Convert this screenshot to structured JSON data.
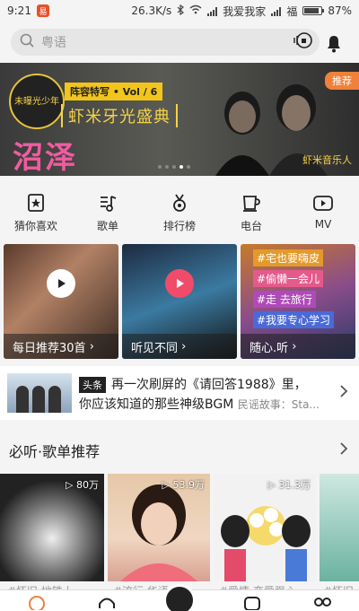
{
  "status_bar": {
    "time": "9:21",
    "notification_badge": "易",
    "network_speed": "26.3K/s",
    "carrier_1": "我爱我家",
    "carrier_2": "福",
    "battery": "87%",
    "battery_level": 0.87
  },
  "search": {
    "placeholder": "粤语",
    "icon": "search-icon",
    "voice_icon": "voice-recognition-icon",
    "bell_icon": "bell-icon"
  },
  "banner": {
    "circle_badge": "未曝光少年",
    "series": "阵容特写 • Vol / 6",
    "headline": "虾米牙光盛典",
    "artist_name": "沼泽",
    "tag": "推荐",
    "brand": "虾米音乐人",
    "dots": 5,
    "active_dot": 3
  },
  "nav": [
    {
      "label": "猜你喜欢",
      "icon": "heart-star-icon"
    },
    {
      "label": "歌单",
      "icon": "playlist-icon"
    },
    {
      "label": "排行榜",
      "icon": "medal-icon"
    },
    {
      "label": "电台",
      "icon": "cup-radio-icon"
    },
    {
      "label": "MV",
      "icon": "mv-play-icon"
    }
  ],
  "cards": [
    {
      "label": "每日推荐30首",
      "icon": "play-icon"
    },
    {
      "label": "听见不同",
      "icon": "play-icon"
    },
    {
      "label": "随心.听",
      "tags": [
        "#宅也要嗨皮",
        "#偷懒一会儿",
        "#走 去旅行",
        "#我要专心学习"
      ]
    }
  ],
  "news": {
    "kind": "头条",
    "line1": "再一次刷屏的《请回答1988》里，",
    "line2": "你应该知道的那些神级BGM",
    "source": "民谣故事：Sta..."
  },
  "section": {
    "title": "必听·歌单推荐"
  },
  "playlists": [
    {
      "count": "80万",
      "caption": "#怀旧 地铁上"
    },
    {
      "count": "53.9万",
      "caption": "#流行 华语金曲"
    },
    {
      "count": "31.3万",
      "caption": "#爱情 恋爱强心"
    },
    {
      "count": "",
      "caption": "#怀旧"
    }
  ],
  "colors": {
    "accent_pink": "#f25ba0",
    "banner_yellow": "#f2c51d",
    "tag_orange": "#f0803a",
    "play_pink": "#f24b6a"
  }
}
